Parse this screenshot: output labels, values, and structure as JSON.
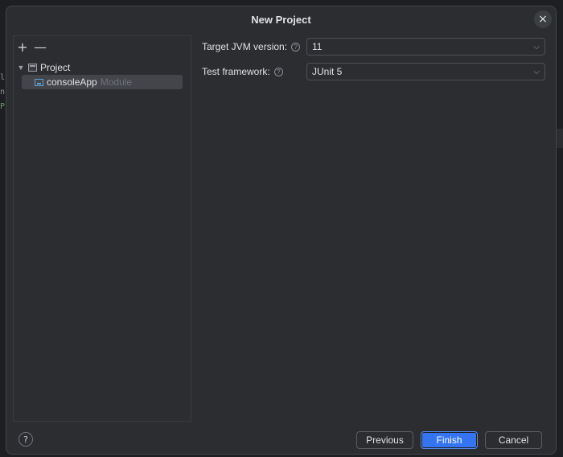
{
  "background": {
    "code_fragments": [
      "li",
      "nc",
      "Pr"
    ]
  },
  "dialog": {
    "title": "New Project",
    "close_glyph": "×"
  },
  "tree": {
    "toolbar": {
      "add_glyph": "+",
      "remove_glyph": "—"
    },
    "project": {
      "label": "Project",
      "expanded": true
    },
    "module": {
      "name": "consoleApp",
      "type": "Module",
      "selected": true
    }
  },
  "form": {
    "jvm": {
      "label": "Target JVM version:",
      "value": "11"
    },
    "test": {
      "label": "Test framework:",
      "value": "JUnit 5"
    },
    "help_glyph": "?"
  },
  "footer": {
    "help_glyph": "?",
    "previous_label": "Previous",
    "finish_label": "Finish",
    "cancel_label": "Cancel"
  },
  "colors": {
    "dialog_bg": "#2b2d30",
    "accent": "#3574f0",
    "selection": "#43454a",
    "module_icon": "#5ca4d9"
  },
  "icons": {
    "close": "close-icon",
    "add": "plus-icon",
    "remove": "minus-icon",
    "project": "project-folder-icon",
    "module": "module-icon",
    "help": "help-icon",
    "dropdown": "chevron-down-icon"
  }
}
